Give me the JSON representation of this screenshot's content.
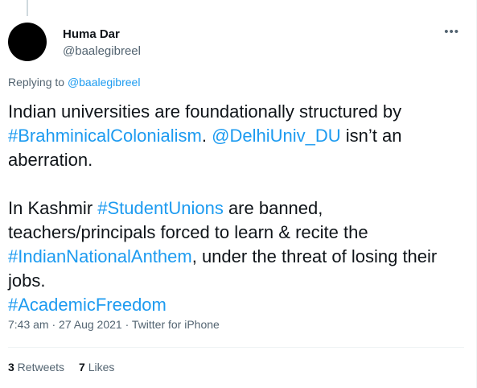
{
  "author": {
    "display_name": "Huma Dar",
    "handle": "@baalegibreel"
  },
  "more_icon": "more-horizontal-icon",
  "replying": {
    "prefix": "Replying to ",
    "handle": "@baalegibreel"
  },
  "tweet": {
    "p1_a": "Indian universities are foundationally structured by ",
    "p1_tag": "#BrahminicalColonialism",
    "p1_b": ". ",
    "p1_mention": "@DelhiUniv_DU",
    "p1_c": " isn’t an aberration.",
    "p2_a": "In Kashmir ",
    "p2_tag1": "#StudentUnions",
    "p2_b": " are banned, teachers/principals forced to learn & recite the ",
    "p2_tag2": "#IndianNationalAnthem",
    "p2_c": ", under the threat of losing their jobs.",
    "p2_tag3": "#AcademicFreedom"
  },
  "meta": {
    "time": "7:43 am",
    "date": "27 Aug 2021",
    "source": "Twitter for iPhone",
    "separator": " · "
  },
  "stats": {
    "retweets_count": "3",
    "retweets_label": " Retweets",
    "likes_count": "7",
    "likes_label": " Likes"
  },
  "colors": {
    "link": "#1d9bf0",
    "secondary": "#536471",
    "primary": "#0f1419"
  }
}
